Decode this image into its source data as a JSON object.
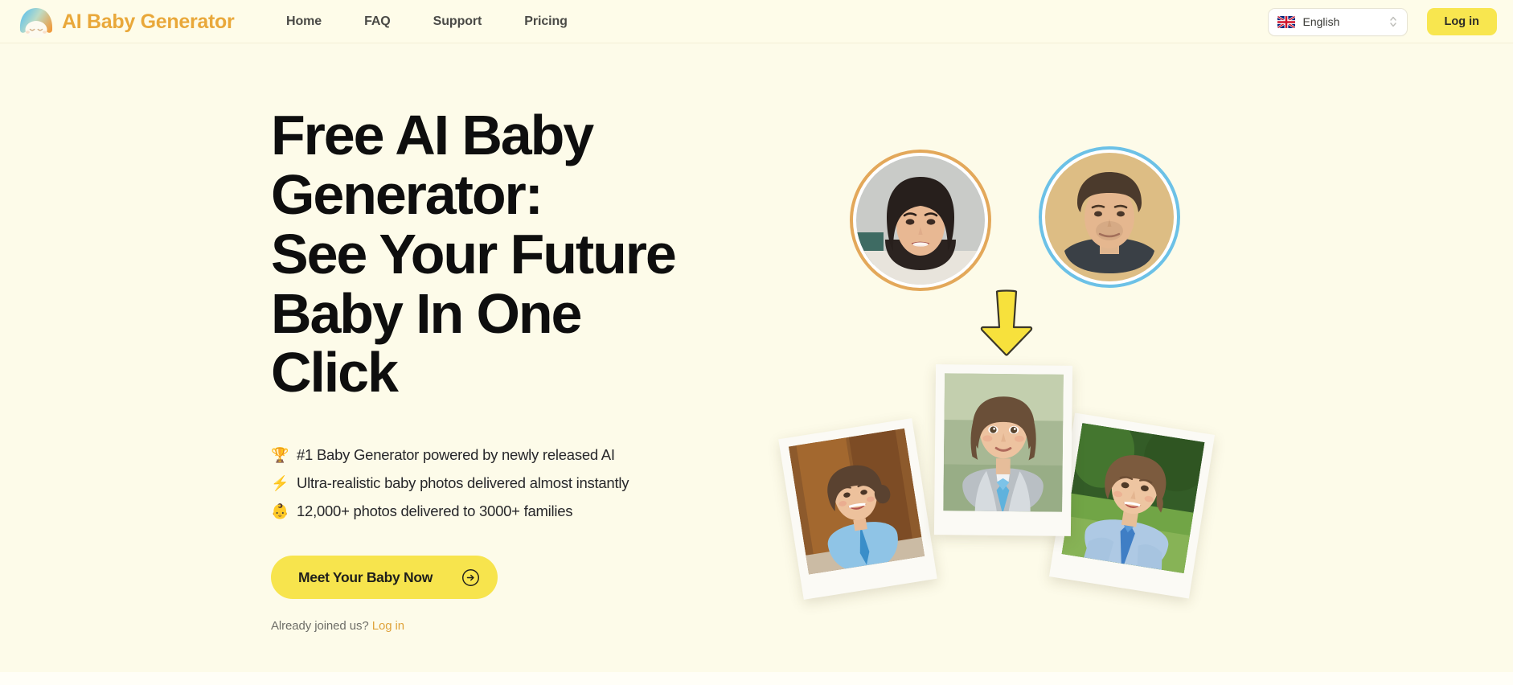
{
  "brand": {
    "name": "AI Baby Generator",
    "logo_icon": "baby-face-logo-icon",
    "logo_gradient_from": "#6cc3e8",
    "logo_gradient_to": "#ef9a3d",
    "text_color": "#e9a83a"
  },
  "nav": {
    "items": [
      {
        "label": "Home"
      },
      {
        "label": "FAQ"
      },
      {
        "label": "Support"
      },
      {
        "label": "Pricing"
      }
    ]
  },
  "header": {
    "language": {
      "value": "English",
      "flag": "uk-flag-icon",
      "chevron": "chevron-up-down-icon"
    },
    "login_label": "Log in",
    "login_bg": "#f8e64f"
  },
  "hero": {
    "title": "Free AI Baby\nGenerator:\nSee Your Future\nBaby In One\nClick",
    "bullets": [
      {
        "emoji": "🏆",
        "icon_name": "trophy-icon",
        "text": "#1 Baby Generator powered by newly released AI"
      },
      {
        "emoji": "⚡",
        "icon_name": "lightning-bolt-icon",
        "text": "Ultra-realistic baby photos delivered almost instantly"
      },
      {
        "emoji": "👶",
        "icon_name": "baby-icon",
        "text": "12,000+ photos delivered to 3000+ families"
      }
    ],
    "cta": {
      "label": "Meet Your Baby Now",
      "arrow_icon": "arrow-right-circle-icon",
      "bg": "#f7e44d"
    },
    "already": {
      "prefix": "Already joined us?",
      "link_label": "Log in",
      "link_color": "#dfa33c"
    }
  },
  "art": {
    "parent_mom": {
      "name": "mother-photo",
      "ring_color": "#e3a85a"
    },
    "parent_dad": {
      "name": "father-photo",
      "ring_color": "#6cc1e6"
    },
    "arrow": {
      "name": "down-arrow-icon",
      "color": "#f7e13c"
    },
    "babies": [
      {
        "name": "baby-photo-left"
      },
      {
        "name": "baby-photo-center"
      },
      {
        "name": "baby-photo-right"
      }
    ]
  },
  "theme": {
    "page_bg": "#fdfbe9",
    "header_bg": "#fefce9",
    "accent_yellow": "#f7e44d",
    "accent_orange": "#e9a83a"
  }
}
